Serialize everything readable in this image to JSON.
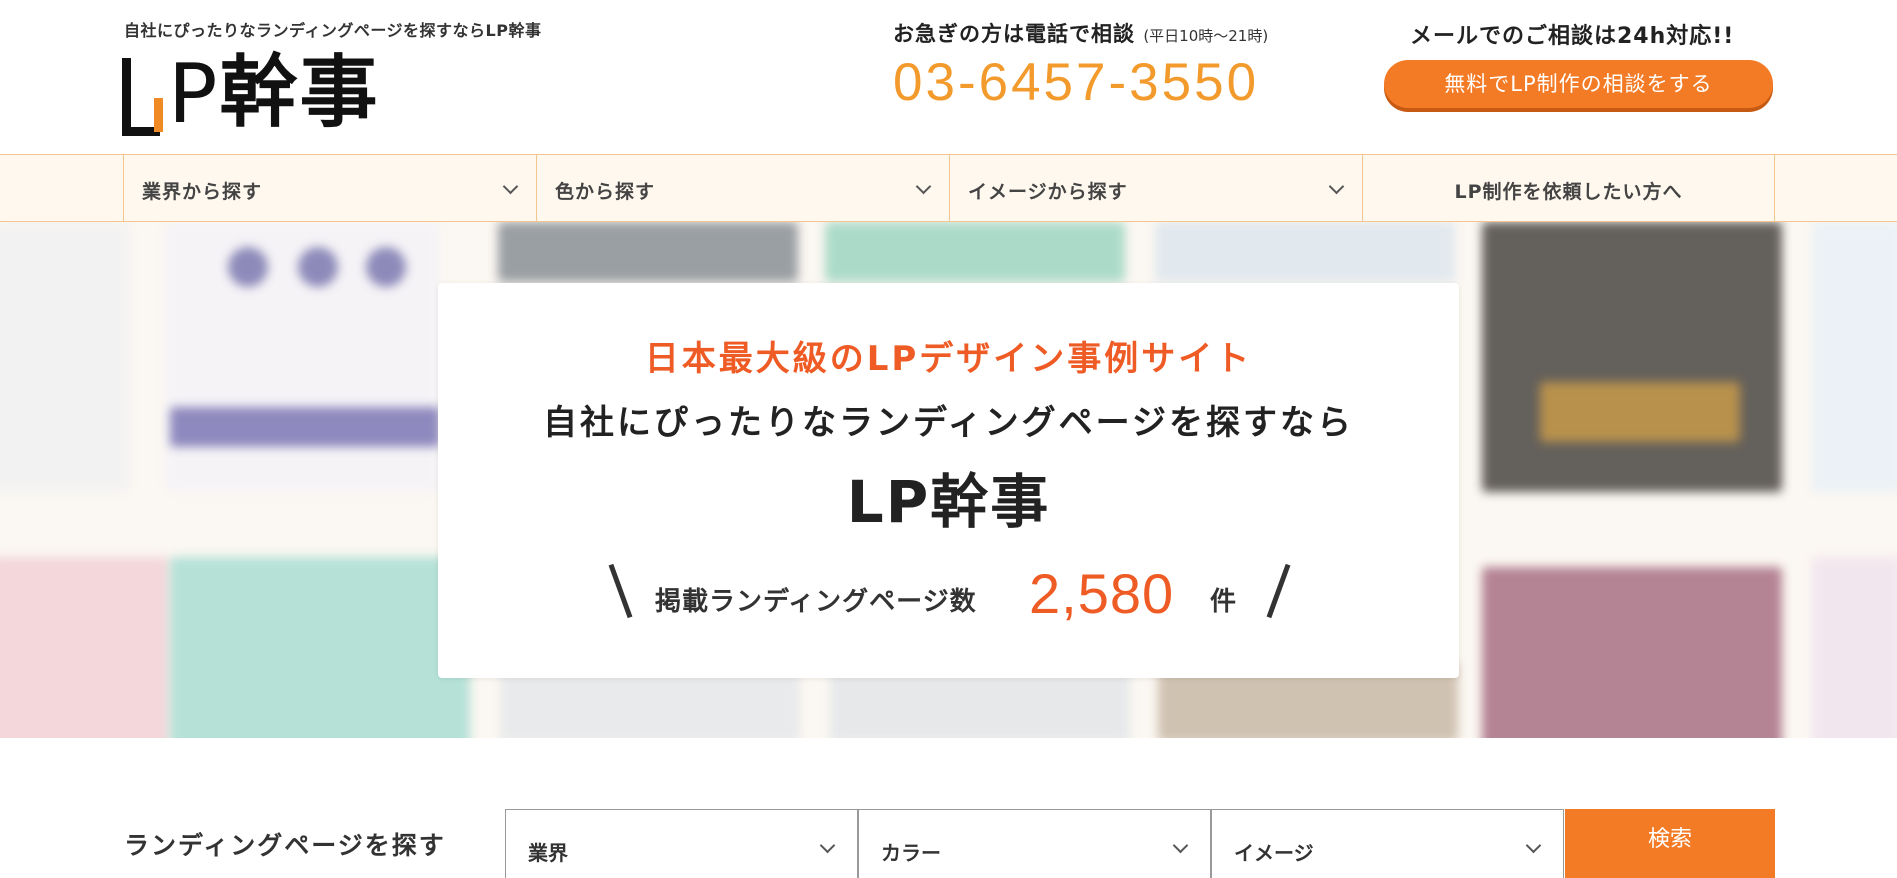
{
  "header": {
    "tagline": "自社にぴったりなランディングページを探すならLP幹事",
    "logo": {
      "p": "P",
      "kanji": "幹事"
    },
    "tel_label": "お急ぎの方は電話で相談",
    "tel_hours": "(平日10時～21時)",
    "tel_number": "03-6457-3550",
    "mail_label": "メールでのご相談は24h対応!!",
    "consult_button": "無料でLP制作の相談をする"
  },
  "nav": {
    "items": [
      {
        "label": "業界から探す",
        "has_dropdown": true
      },
      {
        "label": "色から探す",
        "has_dropdown": true
      },
      {
        "label": "イメージから探す",
        "has_dropdown": true
      },
      {
        "label": "LP制作を依頼したい方へ",
        "has_dropdown": false
      }
    ]
  },
  "hero": {
    "subtitle": "日本最大級のLPデザイン事例サイト",
    "headline": "自社にぴったりなランディングページを探すなら",
    "brand": "LP幹事",
    "count_label": "掲載ランディングページ数",
    "count": "2,580",
    "count_unit": "件"
  },
  "search": {
    "title": "ランディングページを探す",
    "selects": [
      {
        "label": "業界"
      },
      {
        "label": "カラー"
      },
      {
        "label": "イメージ"
      }
    ],
    "button": "検索"
  },
  "colors": {
    "accent_orange": "#f47b25",
    "tel_orange": "#f39a2c",
    "hero_red": "#ef5b25",
    "nav_bg": "#fff8ef",
    "nav_border": "#f2c68e"
  }
}
